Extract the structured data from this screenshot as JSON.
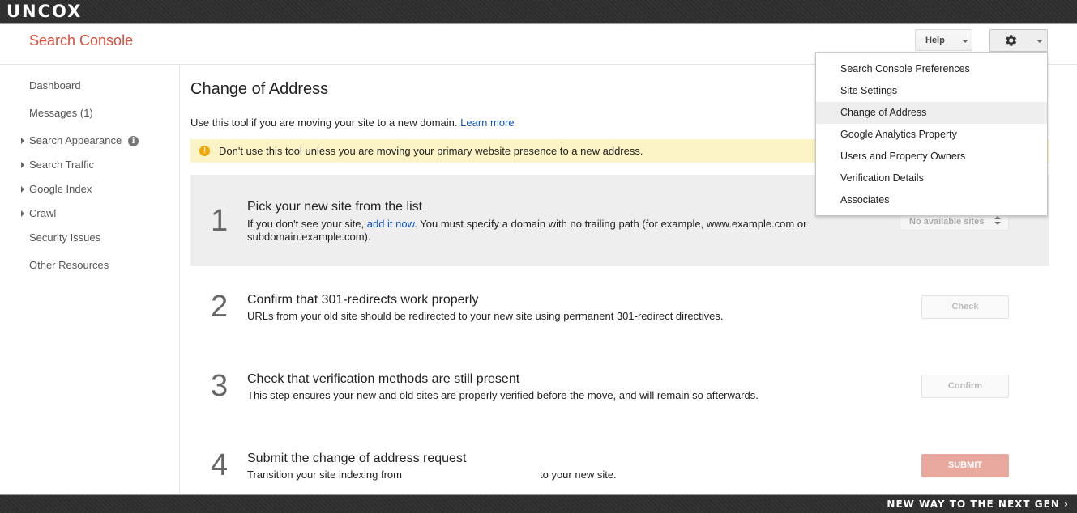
{
  "brand": {
    "logo_text": "UNCOX",
    "tagline": "NEW WAY TO THE NEXT GEN ›"
  },
  "header": {
    "app_title": "Search Console",
    "help_label": "Help"
  },
  "sidebar": {
    "items": [
      {
        "label": "Dashboard"
      },
      {
        "label": "Messages (1)"
      },
      {
        "label": "Search Appearance"
      },
      {
        "label": "Search Traffic"
      },
      {
        "label": "Google Index"
      },
      {
        "label": "Crawl"
      },
      {
        "label": "Security Issues"
      },
      {
        "label": "Other Resources"
      }
    ]
  },
  "main": {
    "title": "Change of Address",
    "intro_text": "Use this tool if you are moving your site to a new domain.",
    "learn_more": "Learn more",
    "warning": "Don't use this tool unless you are moving your primary website presence to a new address.",
    "steps": [
      {
        "number": "1",
        "title": "Pick your new site from the list",
        "desc_before": "If you don't see your site, ",
        "desc_link": "add it now",
        "desc_after": ". You must specify a domain with no trailing path (for example, www.example.com or subdomain.example.com).",
        "select_value": "No available sites"
      },
      {
        "number": "2",
        "title": "Confirm that 301-redirects work properly",
        "desc": "URLs from your old site should be redirected to your new site using permanent 301-redirect directives.",
        "button": "Check"
      },
      {
        "number": "3",
        "title": "Check that verification methods are still present",
        "desc": "This step ensures your new and old sites are properly verified before the move, and will remain so afterwards.",
        "button": "Confirm"
      },
      {
        "number": "4",
        "title": "Submit the change of address request",
        "desc_before": "Transition your site indexing from",
        "desc_after": "to your new site.",
        "button": "SUBMIT"
      }
    ]
  },
  "dropdown": {
    "items": [
      {
        "label": "Search Console Preferences"
      },
      {
        "label": "Site Settings"
      },
      {
        "label": "Change of Address"
      },
      {
        "label": "Google Analytics Property"
      },
      {
        "label": "Users and Property Owners"
      },
      {
        "label": "Verification Details"
      },
      {
        "label": "Associates"
      }
    ],
    "selected": "Change of Address"
  },
  "colors": {
    "accent": "#dd4b39",
    "link": "#1155cc",
    "warning_bg": "#fcf3c6",
    "warning_icon": "#f2a600",
    "submit_bg": "#e8a89d"
  },
  "icons": {
    "settings": "gear-icon",
    "help_menu": "chevron-down-icon",
    "info": "info-icon",
    "warning": "warning-icon"
  }
}
